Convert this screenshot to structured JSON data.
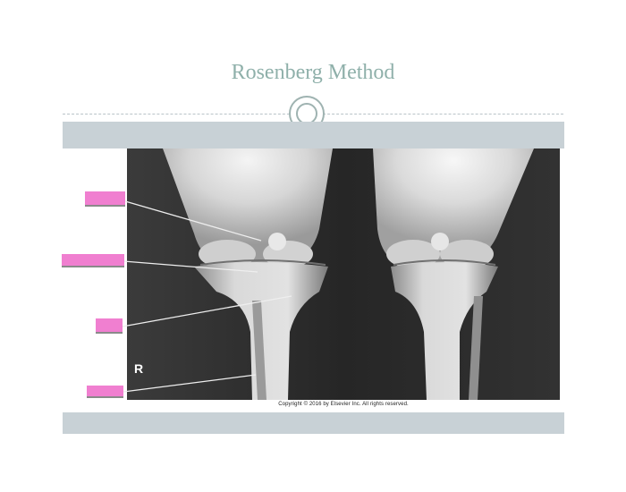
{
  "slide": {
    "title": "Rosenberg Method"
  },
  "image": {
    "description_subject": "bilateral knee radiograph",
    "side_marker": "R",
    "copyright": "Copyright © 2016 by Elsevier Inc. All rights reserved."
  },
  "colors": {
    "title": "#8fb0aa",
    "band": "#c8d1d6",
    "label_cover": "#f07fd0",
    "leader_line": "#f0f0f0"
  },
  "labels": [
    {
      "id": "label-1",
      "text": ""
    },
    {
      "id": "label-2",
      "text": ""
    },
    {
      "id": "label-3",
      "text": ""
    },
    {
      "id": "label-4",
      "text": ""
    }
  ]
}
